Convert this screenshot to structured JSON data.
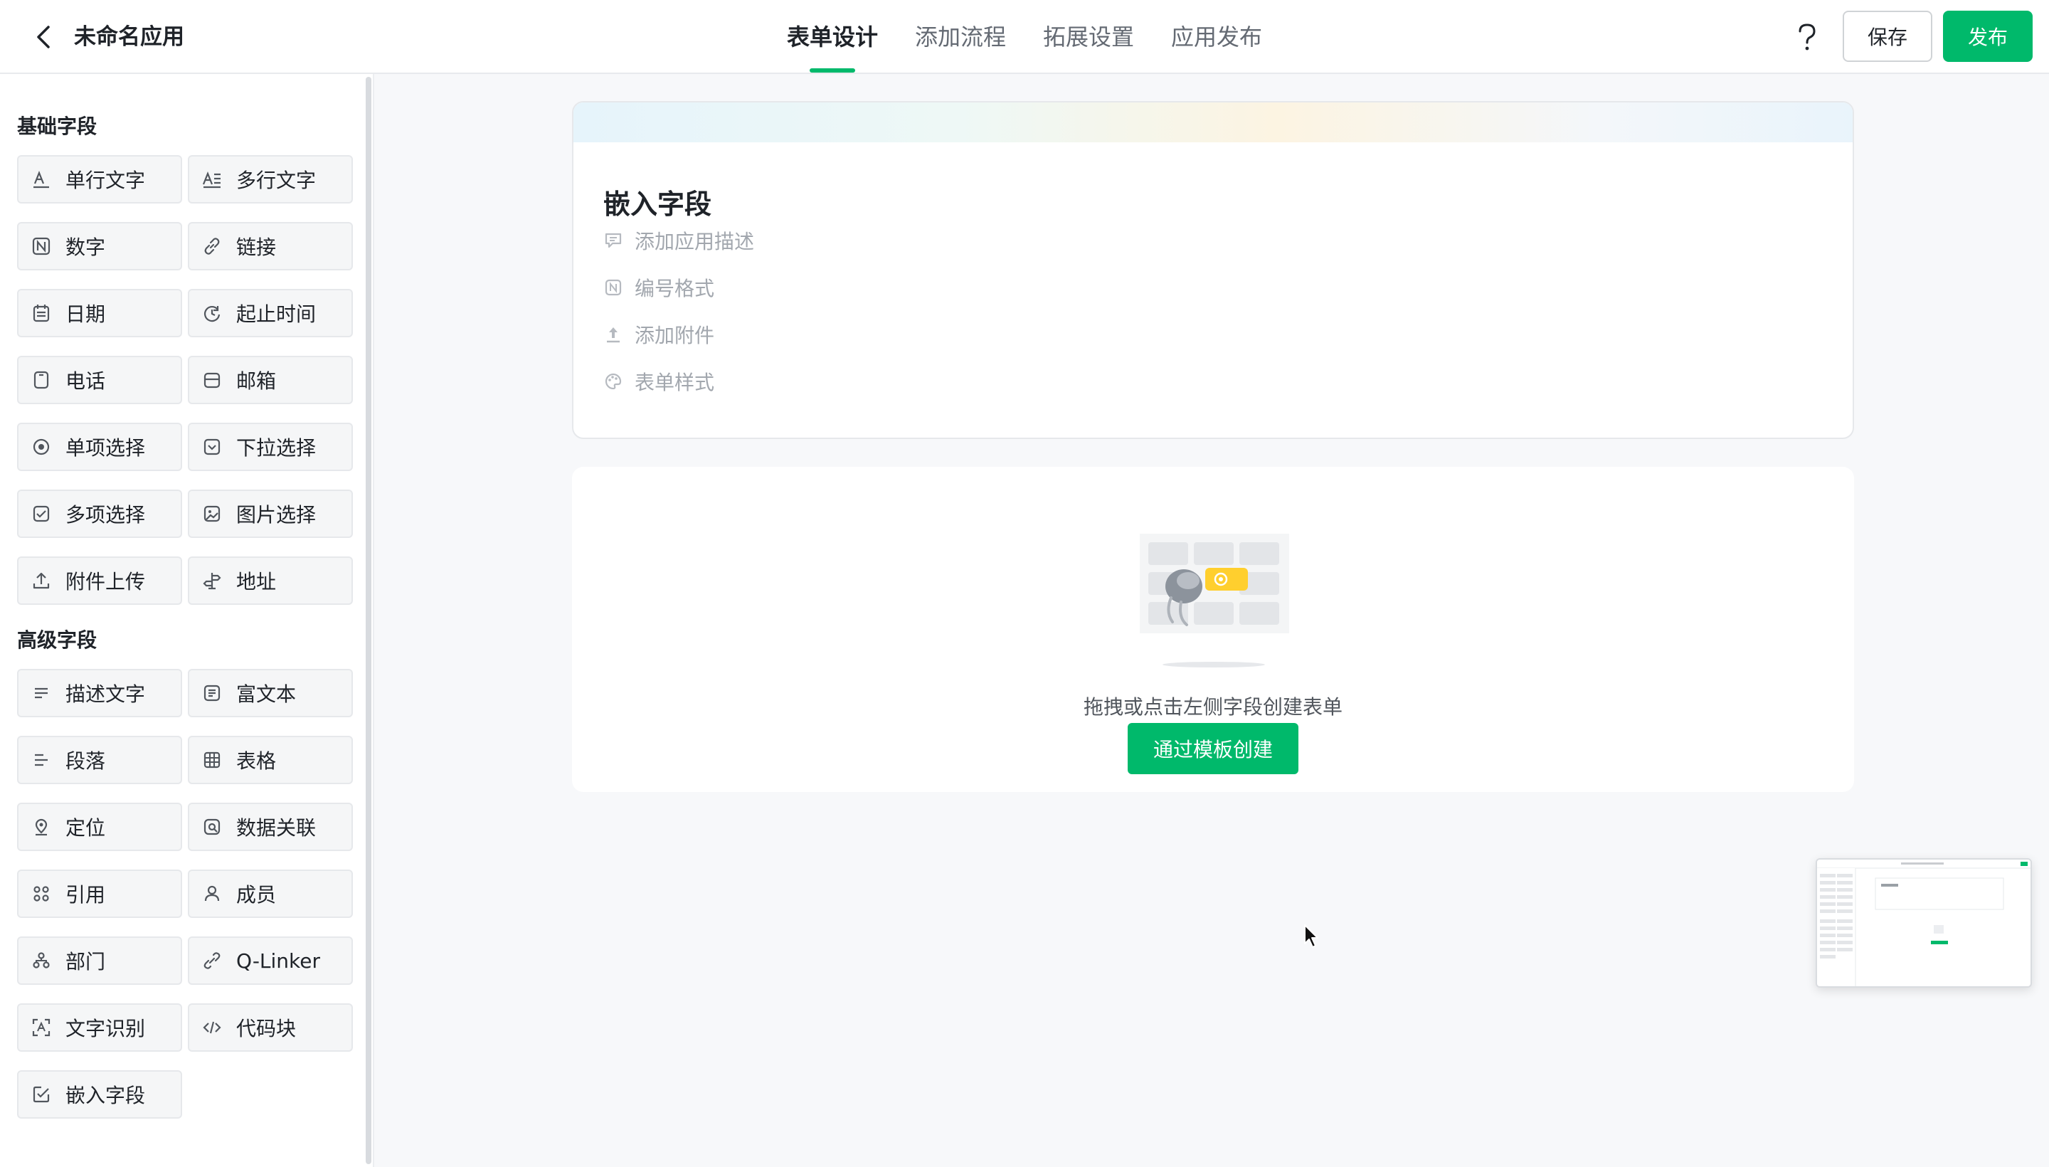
{
  "header": {
    "title": "未命名应用",
    "tabs": [
      {
        "label": "表单设计",
        "active": true
      },
      {
        "label": "添加流程",
        "active": false
      },
      {
        "label": "拓展设置",
        "active": false
      },
      {
        "label": "应用发布",
        "active": false
      }
    ],
    "help_icon": "question-icon",
    "save_label": "保存",
    "publish_label": "发布"
  },
  "sidebar": {
    "basic_title": "基础字段",
    "basic_fields": [
      {
        "label": "单行文字",
        "icon": "single-line-text-icon"
      },
      {
        "label": "多行文字",
        "icon": "multi-line-text-icon"
      },
      {
        "label": "数字",
        "icon": "number-icon"
      },
      {
        "label": "链接",
        "icon": "link-icon"
      },
      {
        "label": "日期",
        "icon": "calendar-icon"
      },
      {
        "label": "起止时间",
        "icon": "time-range-icon"
      },
      {
        "label": "电话",
        "icon": "phone-icon"
      },
      {
        "label": "邮箱",
        "icon": "mail-icon"
      },
      {
        "label": "单项选择",
        "icon": "radio-icon"
      },
      {
        "label": "下拉选择",
        "icon": "dropdown-icon"
      },
      {
        "label": "多项选择",
        "icon": "checkbox-icon"
      },
      {
        "label": "图片选择",
        "icon": "image-icon"
      },
      {
        "label": "附件上传",
        "icon": "upload-icon"
      },
      {
        "label": "地址",
        "icon": "signpost-icon"
      }
    ],
    "advanced_title": "高级字段",
    "advanced_fields": [
      {
        "label": "描述文字",
        "icon": "description-icon"
      },
      {
        "label": "富文本",
        "icon": "rich-text-icon"
      },
      {
        "label": "段落",
        "icon": "paragraph-icon"
      },
      {
        "label": "表格",
        "icon": "table-icon"
      },
      {
        "label": "定位",
        "icon": "location-icon"
      },
      {
        "label": "数据关联",
        "icon": "data-link-icon"
      },
      {
        "label": "引用",
        "icon": "reference-icon"
      },
      {
        "label": "成员",
        "icon": "user-icon"
      },
      {
        "label": "部门",
        "icon": "department-icon"
      },
      {
        "label": "Q-Linker",
        "icon": "q-linker-icon"
      },
      {
        "label": "文字识别",
        "icon": "ocr-icon"
      },
      {
        "label": "代码块",
        "icon": "code-icon"
      },
      {
        "label": "嵌入字段",
        "icon": "embed-icon"
      }
    ]
  },
  "form": {
    "title": "嵌入字段",
    "options": [
      {
        "label": "添加应用描述",
        "icon": "comment-icon"
      },
      {
        "label": "编号格式",
        "icon": "number-format-icon"
      },
      {
        "label": "添加附件",
        "icon": "attachment-upload-icon"
      },
      {
        "label": "表单样式",
        "icon": "palette-icon"
      }
    ]
  },
  "empty_state": {
    "text": "拖拽或点击左侧字段创建表单",
    "button_label": "通过模板创建"
  },
  "colors": {
    "accent": "#00b96b",
    "text_primary": "#1f2329",
    "text_secondary": "#646a73",
    "placeholder": "#a2a7ae",
    "background": "#f7f8fa"
  }
}
